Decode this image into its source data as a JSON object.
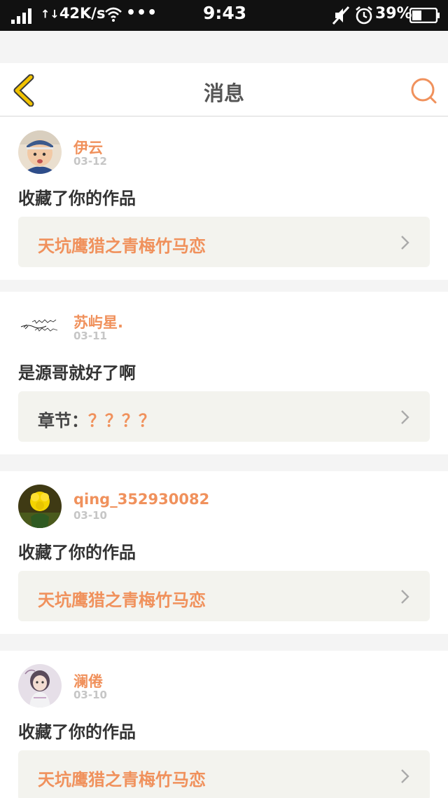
{
  "status_bar": {
    "network_speed": "42K/s",
    "dots": "•••",
    "time": "9:43",
    "battery_percent": "39%"
  },
  "header": {
    "title": "消息",
    "back_icon": "chevron-left-icon",
    "search_icon": "search-icon"
  },
  "colors": {
    "accent": "#f0915c",
    "back_icon": "#f2c300",
    "card_bg": "#f3f3ee"
  },
  "messages": [
    {
      "username": "伊云",
      "date": "03-12",
      "action": "收藏了你的作品",
      "work_prefix": "",
      "work_title": "天坑鹰猎之青梅竹马恋",
      "avatar": "baby-photo"
    },
    {
      "username": "苏屿星.",
      "date": "03-11",
      "action": "是源哥就好了啊",
      "work_prefix": "章节：",
      "work_title": "？？？？",
      "avatar": "calligraphy-image"
    },
    {
      "username": "qing_352930082",
      "date": "03-10",
      "action": "收藏了你的作品",
      "work_prefix": "",
      "work_title": "天坑鹰猎之青梅竹马恋",
      "avatar": "yellow-flower-photo"
    },
    {
      "username": "澜倦",
      "date": "03-10",
      "action": "收藏了你的作品",
      "work_prefix": "",
      "work_title": "天坑鹰猎之青梅竹马恋",
      "avatar": "girl-illustration"
    }
  ]
}
